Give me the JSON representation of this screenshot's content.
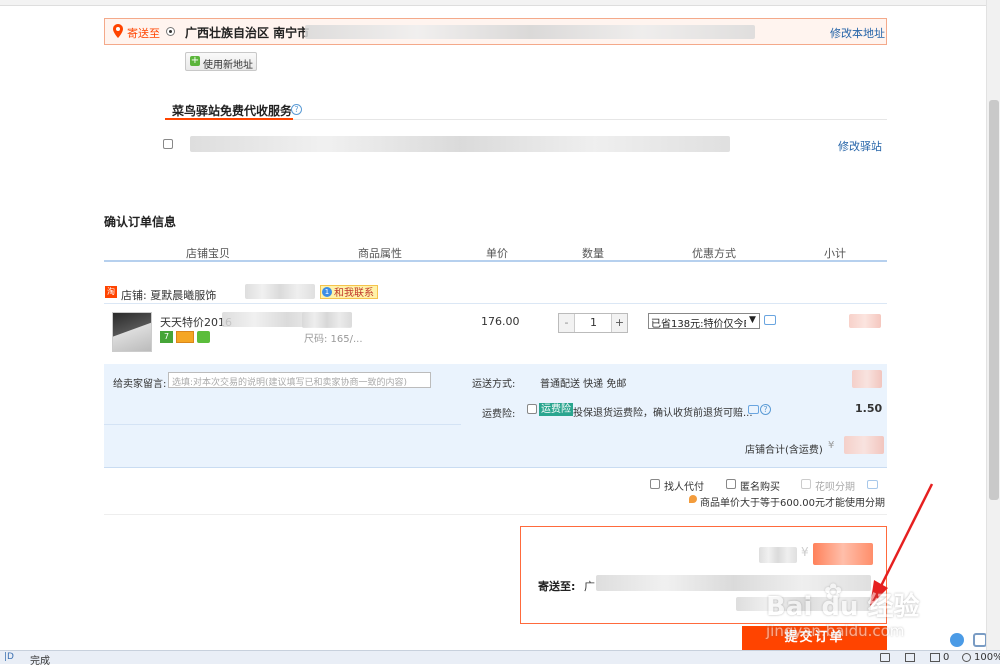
{
  "address": {
    "ship_to_label": "寄送至",
    "address_text": "广西壮族自治区 南宁市",
    "edit_link": "修改本地址",
    "new_address_button": "使用新地址"
  },
  "cainiao": {
    "title": "菜鸟驿站免费代收服务",
    "edit_link": "修改驿站"
  },
  "order": {
    "title": "确认订单信息",
    "columns": [
      "店铺宝贝",
      "商品属性",
      "单价",
      "数量",
      "优惠方式",
      "小计"
    ],
    "shop_label": "店铺: 夏默晨曦服饰",
    "contact_label": "和我联系",
    "item_title": "天天特价2016",
    "item_attr_partial": "尺码: 165/...",
    "price": "176.00",
    "quantity": "1",
    "qty_minus": "-",
    "qty_plus": "+",
    "discount_select": "已省138元:特价仅今E",
    "message_label": "给卖家留言:",
    "message_placeholder": "选填:对本次交易的说明(建议填写已和卖家协商一致的内容)",
    "shipping_label": "运送方式:",
    "shipping_value": "普通配送 快递 免邮",
    "insurance_label": "运费险:",
    "insurance_badge": "运费险",
    "insurance_text": "投保退货运费险，确认收货前退货可赔...",
    "insurance_price": "1.50",
    "shop_total_label": "店铺合计(含运费)",
    "shop_total_prefix": "¥"
  },
  "options": {
    "pay_for_me": "找人代付",
    "anonymous": "匿名购买",
    "huabei": "花呗分期",
    "huabei_note": "商品单价大于等于600.00元才能使用分期"
  },
  "summary": {
    "currency": "¥",
    "ship_to_label": "寄送至:",
    "address_start": "广"
  },
  "submit_button": "提交订单",
  "status": {
    "left_text": "完成",
    "counter": "0",
    "zoom": "100%"
  },
  "watermark": {
    "brand": "Bai du 经验",
    "url": "jingyan.baidu.com"
  },
  "colors": {
    "accent": "#ff4400",
    "link": "#2463a8",
    "header_line": "#b6d0ee",
    "shop_bg": "#eaf3fd"
  }
}
